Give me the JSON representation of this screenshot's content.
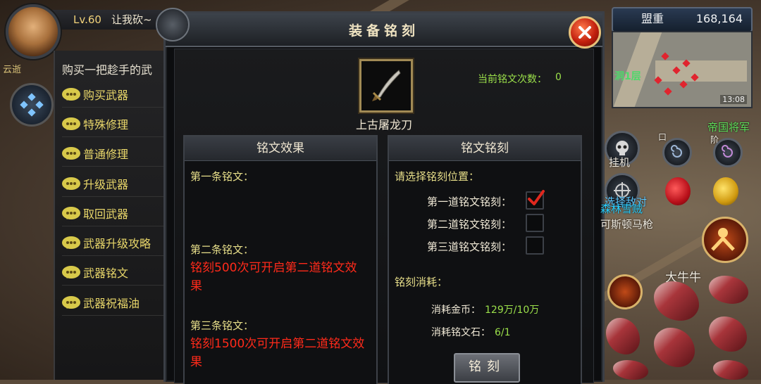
{
  "player": {
    "level": "Lv.60",
    "name": "让我砍~",
    "name_tag": "云逝"
  },
  "npc": {
    "intro": "购买一把趁手的武",
    "options": [
      {
        "label": "购买武器"
      },
      {
        "label": "特殊修理"
      },
      {
        "label": "普通修理"
      },
      {
        "label": "升级武器"
      },
      {
        "label": "取回武器"
      },
      {
        "label": "武器升级攻略"
      },
      {
        "label": "武器铭文"
      },
      {
        "label": "武器祝福油"
      }
    ]
  },
  "dialog": {
    "title": "装备铭刻",
    "count_label": "当前铭文次数：",
    "count_value": "0",
    "weapon_name": "上古屠龙刀",
    "effects": {
      "heading": "铭文效果",
      "first_title": "第一条铭文：",
      "second_title": "第二条铭文：",
      "second_text": "铭刻500次可开启第二道铭文效果",
      "third_title": "第三条铭文：",
      "third_text": "铭刻1500次可开启第二道铭文效果"
    },
    "engrave": {
      "heading": "文铭刻",
      "heading_prefix": "铭",
      "prompt": "请选择铭刻位置：",
      "slots": [
        {
          "label": "第一道铭文铭刻：",
          "checked": true
        },
        {
          "label": "第二道铭文铭刻：",
          "checked": false
        },
        {
          "label": "第三道铭文铭刻：",
          "checked": false
        }
      ],
      "cost_title": "铭刻消耗：",
      "gold_label": "消耗金币：",
      "gold_value": "129万/10万",
      "stone_label": "消耗铭文石：",
      "stone_value": "6/1",
      "button": "铭刻"
    }
  },
  "hud": {
    "alliance_label": "盟重",
    "alliance_value": "168,164",
    "minimap_floor": "洞1层",
    "clock": "13:08",
    "auto_label": "挂机",
    "target_label": "选择敌对",
    "enemy_name": "帝国将军",
    "enemy_title": "森林雪贼",
    "ally_name": "可斯顿马枪",
    "npc_name": "大牛牛",
    "o_label": "口",
    "b_label": "阶"
  },
  "colors": {
    "accent_green": "#9be04a",
    "warning_red": "#ff2a1a",
    "title_gold": "#e8df8a"
  }
}
